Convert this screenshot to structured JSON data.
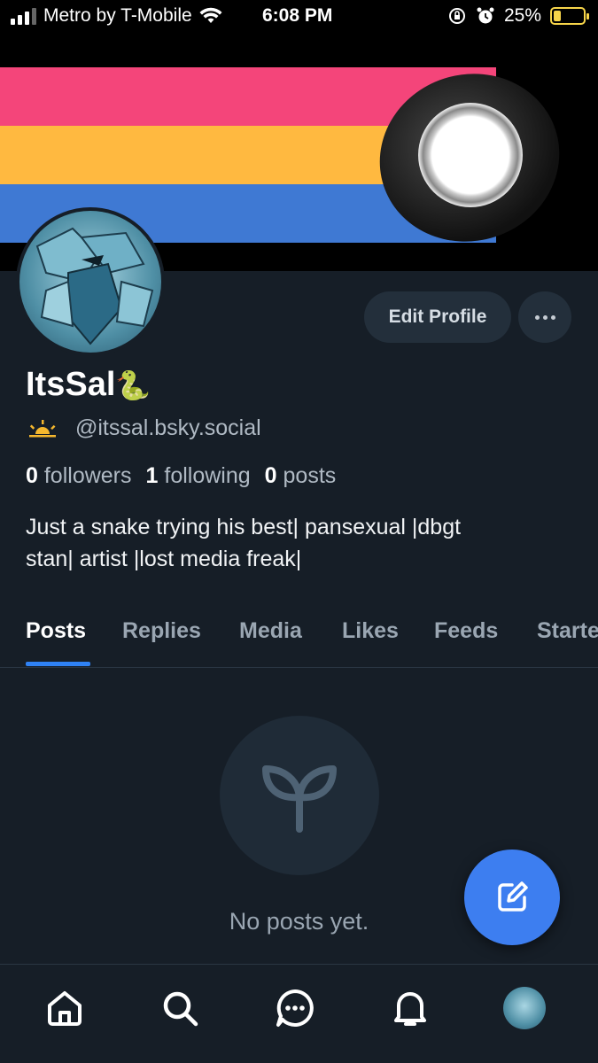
{
  "status_bar": {
    "carrier": "Metro by T-Mobile",
    "time": "6:08 PM",
    "battery_percent": "25%",
    "battery_level": 0.25,
    "icons": [
      "signal-icon",
      "wifi-icon",
      "orientation-lock-icon",
      "alarm-icon",
      "battery-charging-icon"
    ]
  },
  "banner": {
    "stripe_colors": [
      "#f4457a",
      "#ffb940",
      "#3f79d3"
    ]
  },
  "profile": {
    "display_name": "ItsSal",
    "name_emoji": "🐍",
    "handle_emoji": "sunrise-icon",
    "handle": "@itssal.bsky.social",
    "stats": {
      "followers_count": "0",
      "followers_label": "followers",
      "following_count": "1",
      "following_label": "following",
      "posts_count": "0",
      "posts_label": "posts"
    },
    "bio_line1": "Just a snake trying his best| pansexual |dbgt",
    "bio_line2": "stan| artist |lost media freak|"
  },
  "actions": {
    "edit_profile": "Edit Profile",
    "more": "more-icon"
  },
  "tabs": [
    {
      "label": "Posts",
      "active": true
    },
    {
      "label": "Replies",
      "active": false
    },
    {
      "label": "Media",
      "active": false
    },
    {
      "label": "Likes",
      "active": false
    },
    {
      "label": "Feeds",
      "active": false
    },
    {
      "label": "Starter Packs",
      "active": false
    }
  ],
  "empty_state": {
    "icon": "sprout-icon",
    "message": "No posts yet."
  },
  "fab": {
    "icon": "compose-icon"
  },
  "bottom_nav": [
    {
      "icon": "home-icon"
    },
    {
      "icon": "search-icon"
    },
    {
      "icon": "chat-icon"
    },
    {
      "icon": "bell-icon"
    },
    {
      "icon": "profile-avatar"
    }
  ],
  "colors": {
    "background": "#161e27",
    "accent": "#3d7ef0",
    "tab_underline": "#2f82f5",
    "button_bg": "#232f3b",
    "muted_text": "#9aa6b2"
  }
}
